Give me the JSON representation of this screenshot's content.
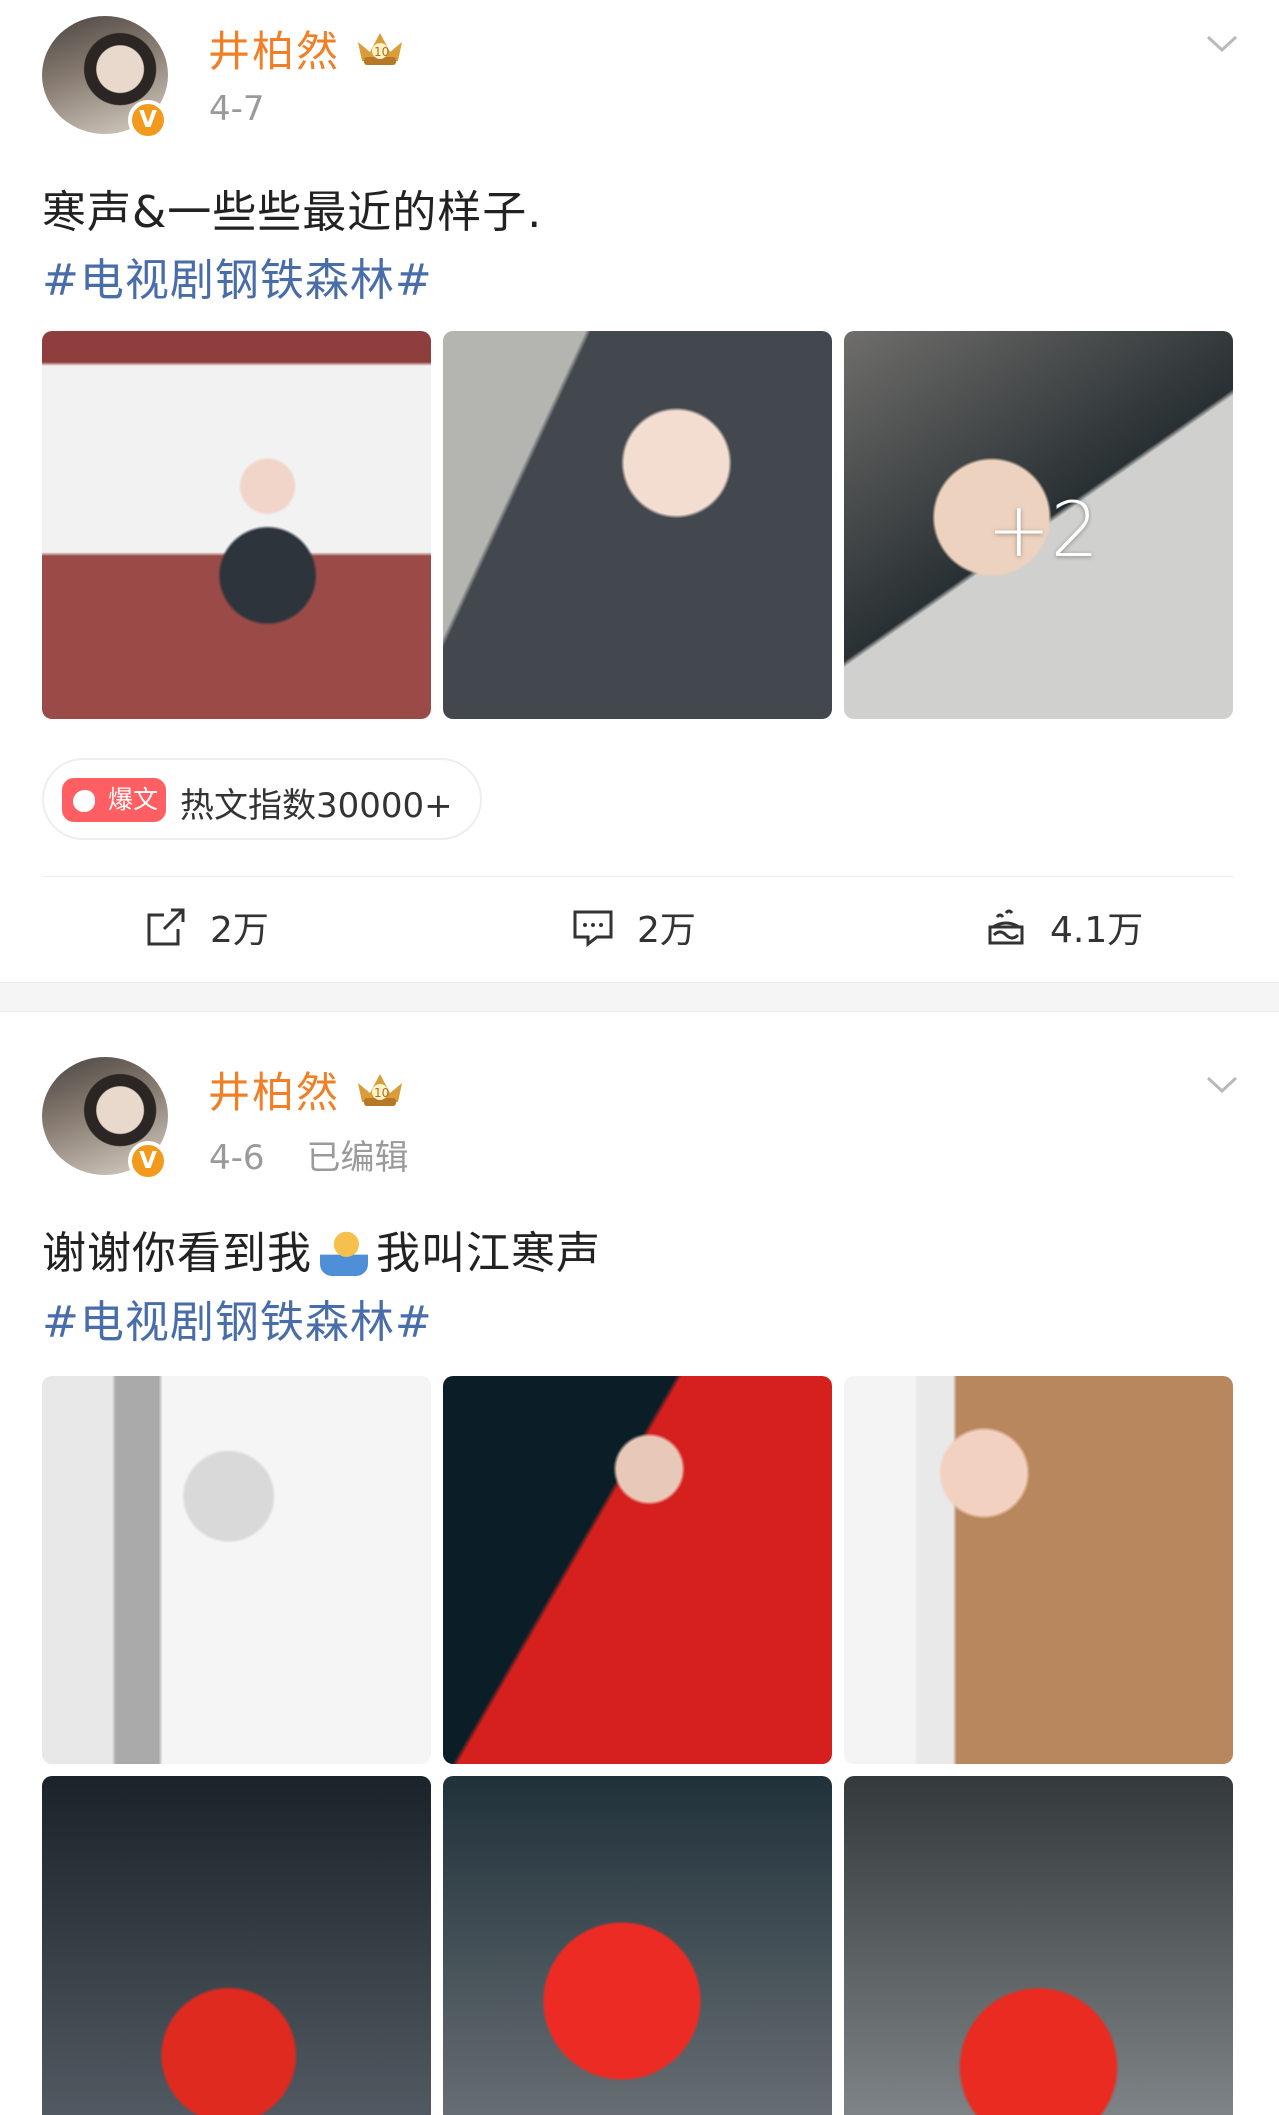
{
  "posts": [
    {
      "username": "井柏然",
      "avatar_badge": "V",
      "time": "4-7",
      "content": "寒声&一些些最近的样子.",
      "hashtag": "#电视剧钢铁森林#",
      "photos": {
        "shown": 3,
        "extra_count": "+2"
      },
      "hot": {
        "tag": "爆文",
        "text": "热文指数30000+"
      },
      "actions": {
        "repost": "2万",
        "comment": "2万",
        "like": "4.1万"
      }
    },
    {
      "username": "井柏然",
      "avatar_badge": "V",
      "time": "4-6",
      "edited": "已编辑",
      "content_before_emoji": "谢谢你看到我",
      "content_after_emoji": "我叫江寒声",
      "hashtag": "#电视剧钢铁森林#",
      "photos": {
        "shown": 6
      }
    }
  ],
  "icons": {
    "crown": "crown-level-icon",
    "more": "chevron-down-icon",
    "repost": "repost-icon",
    "comment": "comment-icon",
    "like": "like-icon",
    "hot": "fire-icon",
    "emoji": "raising-hand-emoji"
  },
  "colors": {
    "username": "#f07f26",
    "hashtag": "#496da8",
    "hot_tag": "#ff5f62",
    "secondary_text": "#9a9a9a"
  }
}
